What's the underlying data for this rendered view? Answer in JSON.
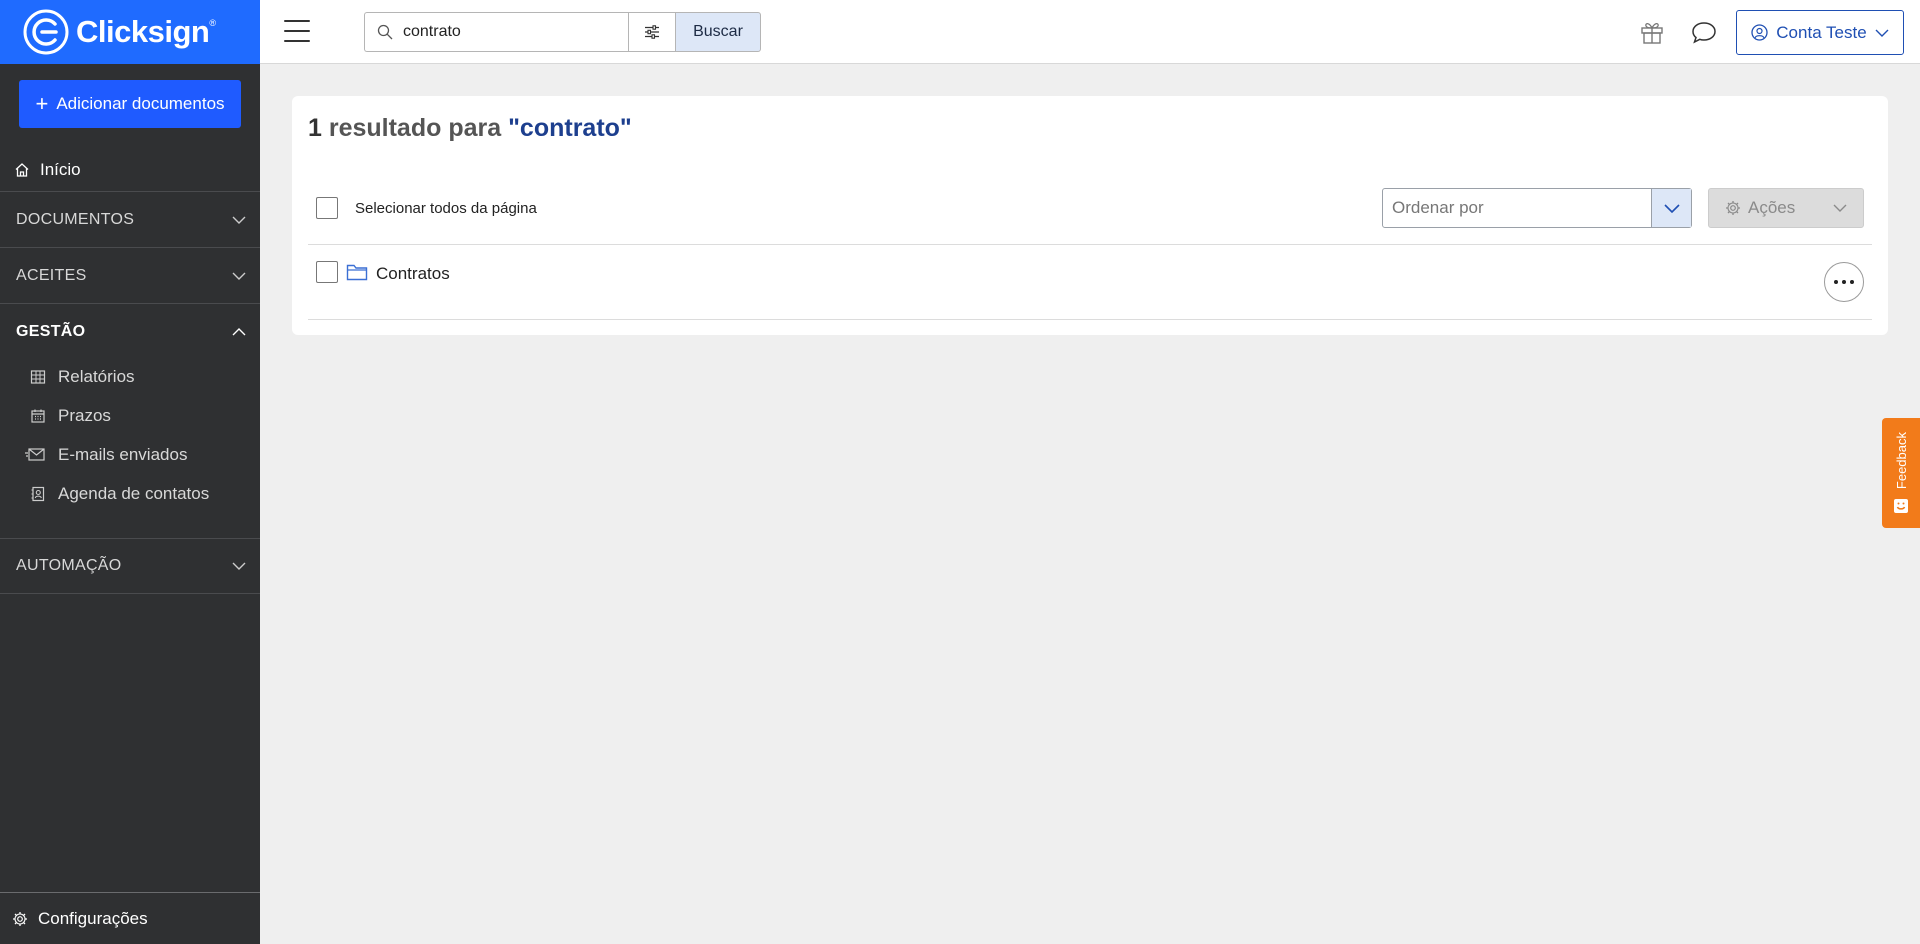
{
  "brand": {
    "name": "Clicksign",
    "trademark": "®"
  },
  "sidebar": {
    "add_documents": "Adicionar documentos",
    "home": "Início",
    "sections": {
      "documentos": "DOCUMENTOS",
      "aceites": "ACEITES",
      "gestao": "GESTÃO",
      "automacao": "AUTOMAÇÃO"
    },
    "gestao_items": [
      {
        "label": "Relatórios",
        "icon": "table-icon"
      },
      {
        "label": "Prazos",
        "icon": "calendar-icon"
      },
      {
        "label": "E-mails enviados",
        "icon": "email-icon"
      },
      {
        "label": "Agenda de contatos",
        "icon": "contact-book-icon"
      }
    ],
    "settings": "Configurações"
  },
  "topbar": {
    "search_value": "contrato",
    "search_button": "Buscar",
    "account": "Conta Teste"
  },
  "results": {
    "count": "1",
    "text": " resultado para ",
    "query": "\"contrato\"",
    "select_all": "Selecionar todos da página",
    "order_placeholder": "Ordenar por",
    "actions": "Ações",
    "rows": [
      {
        "name": "Contratos",
        "type": "folder-icon"
      }
    ]
  },
  "feedback": "Feedback",
  "colors": {
    "brand_blue": "#1f6bff",
    "sidebar_bg": "#2f3032",
    "account_blue": "#1f4fb3",
    "query_blue": "#1d3f8e",
    "feedback_orange": "#f27b1a"
  }
}
